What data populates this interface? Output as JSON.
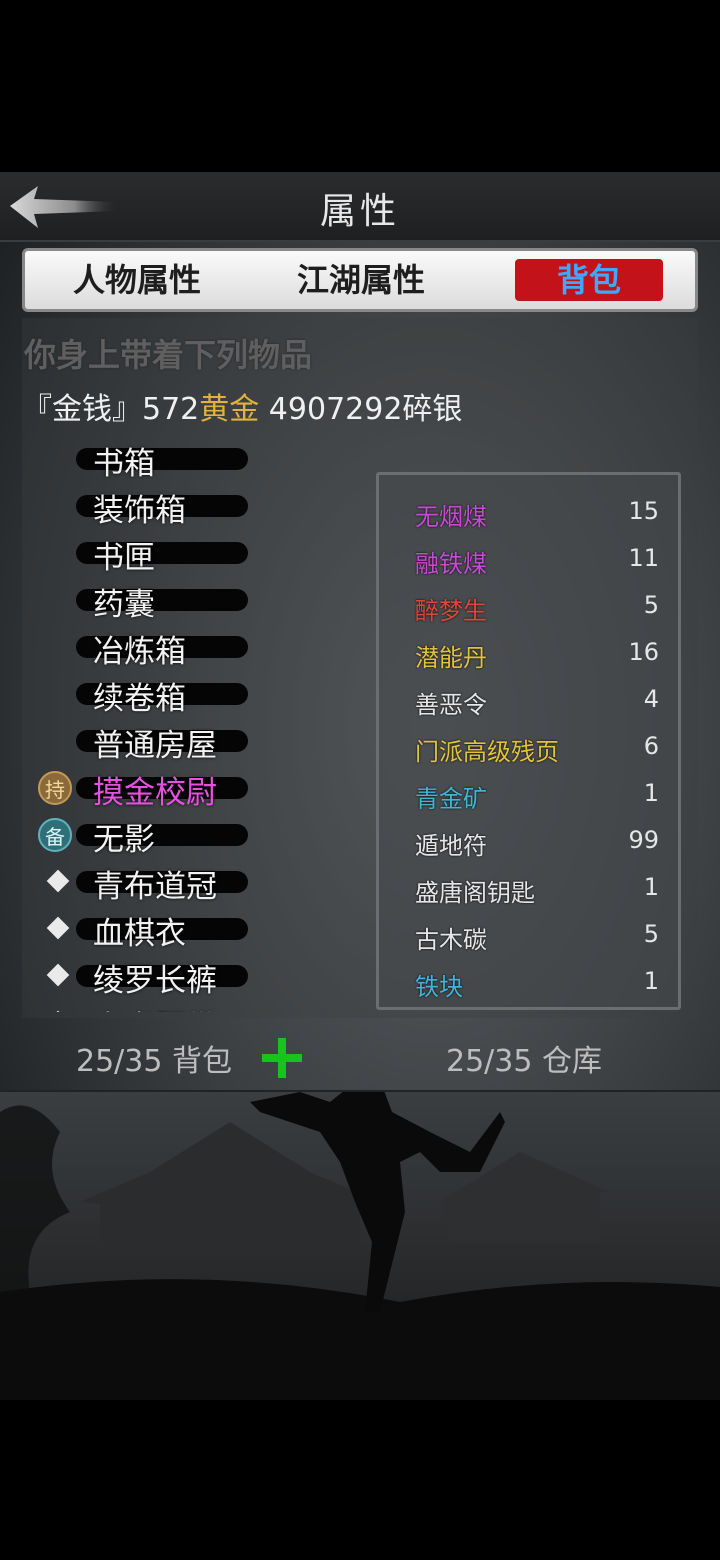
{
  "header": {
    "title": "属性"
  },
  "tabs": [
    {
      "label": "人物属性"
    },
    {
      "label": "江湖属性"
    },
    {
      "label": "背包"
    }
  ],
  "intro": "你身上带着下列物品",
  "money": {
    "prefix": "『金钱』572",
    "gold_word": "黄金",
    "suffix": " 4907292碎银"
  },
  "items": [
    {
      "label": "书箱"
    },
    {
      "label": "装饰箱"
    },
    {
      "label": "书匣"
    },
    {
      "label": "药囊"
    },
    {
      "label": "冶炼箱"
    },
    {
      "label": "续卷箱"
    },
    {
      "label": "普通房屋"
    },
    {
      "label": "摸金校尉",
      "badge": "持",
      "color": "#e552e0"
    },
    {
      "label": "无影",
      "badge": "备"
    },
    {
      "label": "青布道冠"
    },
    {
      "label": "血棋衣"
    },
    {
      "label": "绫罗长裤"
    },
    {
      "label": "白虎腰带"
    }
  ],
  "resources": [
    {
      "name": "无烟煤",
      "qty": "15",
      "color": "#c84ad6"
    },
    {
      "name": "融铁煤",
      "qty": "11",
      "color": "#c84ad6"
    },
    {
      "name": "醉梦生",
      "qty": "5",
      "color": "#e0453b"
    },
    {
      "name": "潜能丹",
      "qty": "16",
      "color": "#e3c33a"
    },
    {
      "name": "善恶令",
      "qty": "4",
      "color": "#e6e6e6"
    },
    {
      "name": "门派高级残页",
      "qty": "6",
      "color": "#e3c33a"
    },
    {
      "name": "青金矿",
      "qty": "1",
      "color": "#3fb6d8"
    },
    {
      "name": "遁地符",
      "qty": "99",
      "color": "#e6e6e6"
    },
    {
      "name": "盛唐阁钥匙",
      "qty": "1",
      "color": "#e6e6e6"
    },
    {
      "name": "古木碳",
      "qty": "5",
      "color": "#e6e6e6"
    },
    {
      "name": "铁块",
      "qty": "1",
      "color": "#3fb6d8"
    }
  ],
  "footer": {
    "bag": "25/35 背包",
    "warehouse": "25/35 仓库"
  },
  "colors": {
    "active_tab_bg": "#c4121a",
    "active_tab_text": "#3ea7ff",
    "gold": "#e3b23c",
    "add_button": "#17c41d"
  },
  "icons": {
    "back": "back-arrow-icon",
    "add": "plus-icon",
    "equipped": "diamond-icon"
  }
}
